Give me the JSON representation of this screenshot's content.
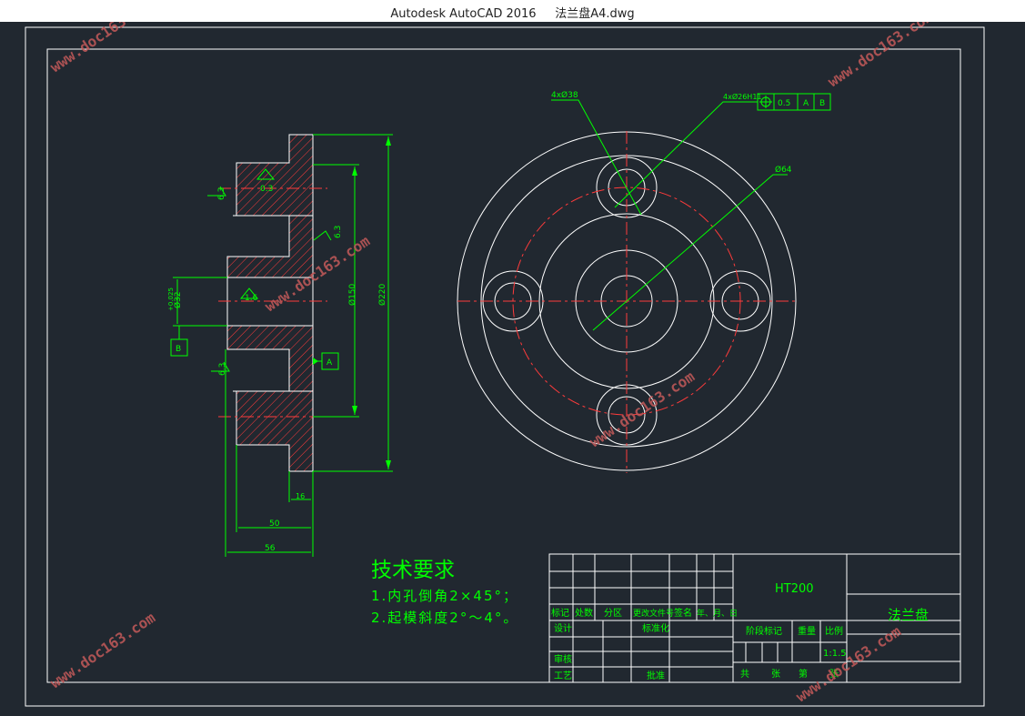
{
  "window": {
    "app_title": "Autodesk AutoCAD 2016",
    "file_name": "法兰盘A4.dwg"
  },
  "dimensions": {
    "holes_4x38": "4xØ38",
    "holes_4x26": "4xØ26H11",
    "position_tol": "0.5",
    "datum_a": "A",
    "datum_b": "B",
    "bolt_circle": "Ø64",
    "dia_220": "Ø220",
    "dia_150": "Ø150",
    "dia_32": "Ø32",
    "dia_32_tol": "+0.025",
    "width_50": "50",
    "width_56": "56",
    "width_16": "16",
    "rough_63": "6.3",
    "rough_16": "1.6",
    "rough_3": "0.3"
  },
  "tech_requirements": {
    "heading": "技术要求",
    "line1": "1.内孔倒角2×45°；",
    "line2": "2.起模斜度2°～4°。"
  },
  "title_block": {
    "material": "HT200",
    "part_name": "法兰盘",
    "scale": "1:1.5",
    "headers": [
      "标记",
      "处数",
      "分区",
      "更改文件号",
      "签名",
      "年、月、日"
    ],
    "design": "设计",
    "standardize": "标准化",
    "review": "审核",
    "process": "工艺",
    "approve": "批准",
    "stage_mark": "阶段标记",
    "weight": "重量",
    "ratio": "比例",
    "total": "共",
    "sheets": "张",
    "sheet_no": "第",
    "page": "张"
  },
  "watermark": {
    "text": "www.doc163.com"
  },
  "colors": {
    "background": "#212830",
    "line": "#ffffff",
    "dimension": "#00ff00",
    "center": "#ff0000",
    "hatch": "#ff3b3b"
  }
}
